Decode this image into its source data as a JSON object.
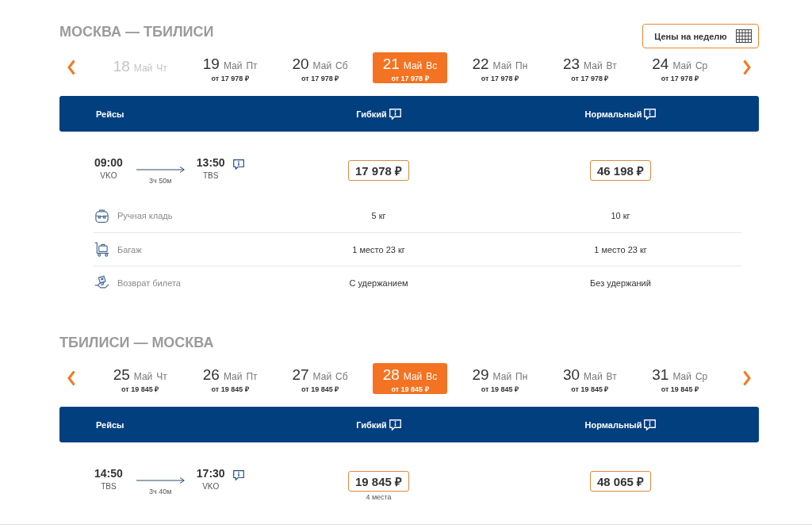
{
  "sections": [
    {
      "route_title": "МОСКВА — ТБИЛИСИ",
      "week_prices_button": {
        "label": "Цены на неделю"
      },
      "dates": [
        {
          "day": "18",
          "month": "Май",
          "weekday": "Чт",
          "selected": false,
          "disabled": true
        },
        {
          "day": "19",
          "month": "Май",
          "weekday": "Пт",
          "price": "от 17 978 ₽",
          "selected": false,
          "disabled": false
        },
        {
          "day": "20",
          "month": "Май",
          "weekday": "Сб",
          "price": "от 17 978 ₽",
          "selected": false,
          "disabled": false
        },
        {
          "day": "21",
          "month": "Май",
          "weekday": "Вс",
          "price": "от 17 978 ₽",
          "selected": true,
          "disabled": false
        },
        {
          "day": "22",
          "month": "Май",
          "weekday": "Пн",
          "price": "от 17 978 ₽",
          "selected": false,
          "disabled": false
        },
        {
          "day": "23",
          "month": "Май",
          "weekday": "Вт",
          "price": "от 17 978 ₽",
          "selected": false,
          "disabled": false
        },
        {
          "day": "24",
          "month": "Май",
          "weekday": "Ср",
          "price": "от 17 978 ₽",
          "selected": false,
          "disabled": false
        }
      ],
      "table": {
        "columns": [
          {
            "label": "Рейсы",
            "info_icon": false
          },
          {
            "label": "Гибкий",
            "info_icon": true
          },
          {
            "label": "Нормальный",
            "info_icon": true
          }
        ],
        "flights": [
          {
            "departure_time": "09:00",
            "departure_airport": "VKO",
            "duration": "3ч 50м",
            "arrival_time": "13:50",
            "arrival_airport": "TBS",
            "fares": [
              {
                "price": "17 978 ₽"
              },
              {
                "price": "46 198 ₽"
              }
            ],
            "amenities": [
              {
                "kind": "hand_luggage",
                "label": "Ручная кладь",
                "values": [
                  "5 кг",
                  "10 кг"
                ]
              },
              {
                "kind": "baggage",
                "label": "Багаж",
                "values": [
                  "1 место 23 кг",
                  "1 место 23 кг"
                ]
              },
              {
                "kind": "refund",
                "label": "Возврат билета",
                "values": [
                  "С удержанием",
                  "Без удержаний"
                ]
              }
            ]
          }
        ]
      }
    },
    {
      "route_title": "ТБИЛИСИ — МОСКВА",
      "dates": [
        {
          "day": "25",
          "month": "Май",
          "weekday": "Чт",
          "price": "от 19 845 ₽",
          "selected": false,
          "disabled": false
        },
        {
          "day": "26",
          "month": "Май",
          "weekday": "Пт",
          "price": "от 19 845 ₽",
          "selected": false,
          "disabled": false
        },
        {
          "day": "27",
          "month": "Май",
          "weekday": "Сб",
          "price": "от 19 845 ₽",
          "selected": false,
          "disabled": false
        },
        {
          "day": "28",
          "month": "Май",
          "weekday": "Вс",
          "price": "от 19 845 ₽",
          "selected": true,
          "disabled": false
        },
        {
          "day": "29",
          "month": "Май",
          "weekday": "Пн",
          "price": "от 19 845 ₽",
          "selected": false,
          "disabled": false
        },
        {
          "day": "30",
          "month": "Май",
          "weekday": "Вт",
          "price": "от 19 845 ₽",
          "selected": false,
          "disabled": false
        },
        {
          "day": "31",
          "month": "Май",
          "weekday": "Ср",
          "price": "от 19 845 ₽",
          "selected": false,
          "disabled": false
        }
      ],
      "table": {
        "columns": [
          {
            "label": "Рейсы",
            "info_icon": false
          },
          {
            "label": "Гибкий",
            "info_icon": true
          },
          {
            "label": "Нормальный",
            "info_icon": true
          }
        ],
        "flights": [
          {
            "departure_time": "14:50",
            "departure_airport": "TBS",
            "duration": "3ч 40м",
            "arrival_time": "17:30",
            "arrival_airport": "VKO",
            "fares": [
              {
                "price": "19 845 ₽",
                "seats_left": "4 места"
              },
              {
                "price": "48 065 ₽"
              }
            ]
          }
        ]
      }
    }
  ]
}
